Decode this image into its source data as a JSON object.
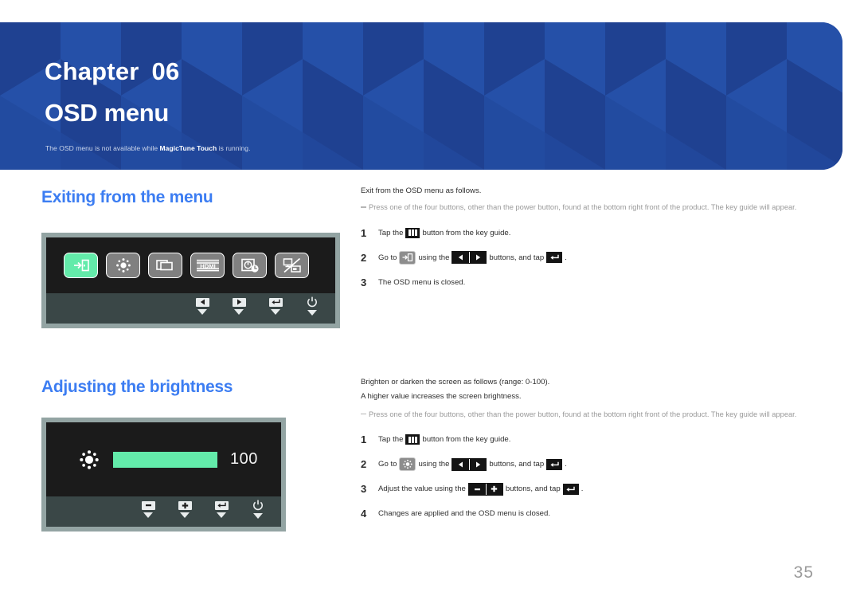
{
  "document": {
    "page_number": "35"
  },
  "banner": {
    "chapter_label": "Chapter",
    "chapter_number": "06",
    "title": "OSD menu",
    "note_prefix": "The OSD menu is not available while ",
    "note_bold": "MagicTune Touch",
    "note_suffix": " is running.",
    "bg_color": "#21479B"
  },
  "sections": [
    {
      "id": "exiting",
      "heading": "Exiting from the menu",
      "heading_color": "#3C7DF2",
      "lead": "Exit from the OSD menu as follows.",
      "note": "Press one of the four buttons, other than the power button, found at the bottom right front of the product. The key guide will appear.",
      "steps": [
        {
          "num": "1",
          "pre": "Tap the",
          "post": "button from the key guide."
        },
        {
          "num": "2",
          "pre": "Go to",
          "mid": "using the",
          "post": "buttons, and tap",
          "tail": "."
        },
        {
          "num": "3",
          "pre": "The OSD menu is closed."
        }
      ],
      "osd": {
        "selected_icon": "exit-icon",
        "icons": [
          "exit-icon",
          "brightness-icon",
          "screen-adjustment-icon",
          "hdmi-source-icon",
          "eco-timer-icon",
          "display-off-icon"
        ],
        "keys": [
          "left-arrow-key",
          "right-arrow-key",
          "enter-key",
          "power-key"
        ],
        "selected_color": "#63EBAA"
      }
    },
    {
      "id": "brightness",
      "heading": "Adjusting the brightness",
      "heading_color": "#3C7DF2",
      "lead": "Brighten or darken the screen as follows (range: 0-100).",
      "lead2": "A higher value increases the screen brightness.",
      "note": "Press one of the four buttons, other than the power button, found at the bottom right front of the product. The key guide will appear.",
      "steps": [
        {
          "num": "1",
          "pre": "Tap the",
          "post": "button from the key guide."
        },
        {
          "num": "2",
          "pre": "Go to",
          "mid": "using the",
          "post": "buttons, and tap",
          "tail": "."
        },
        {
          "num": "3",
          "pre": "Adjust the value using the",
          "post": "buttons, and tap",
          "tail": "."
        },
        {
          "num": "4",
          "pre": "Changes are applied and the OSD menu is closed."
        }
      ],
      "osd": {
        "icon": "brightness-icon",
        "value": "100",
        "bar_color": "#63EBAA",
        "bar_percent": 100,
        "keys": [
          "minus-key",
          "plus-key",
          "enter-key",
          "power-key"
        ]
      }
    }
  ]
}
